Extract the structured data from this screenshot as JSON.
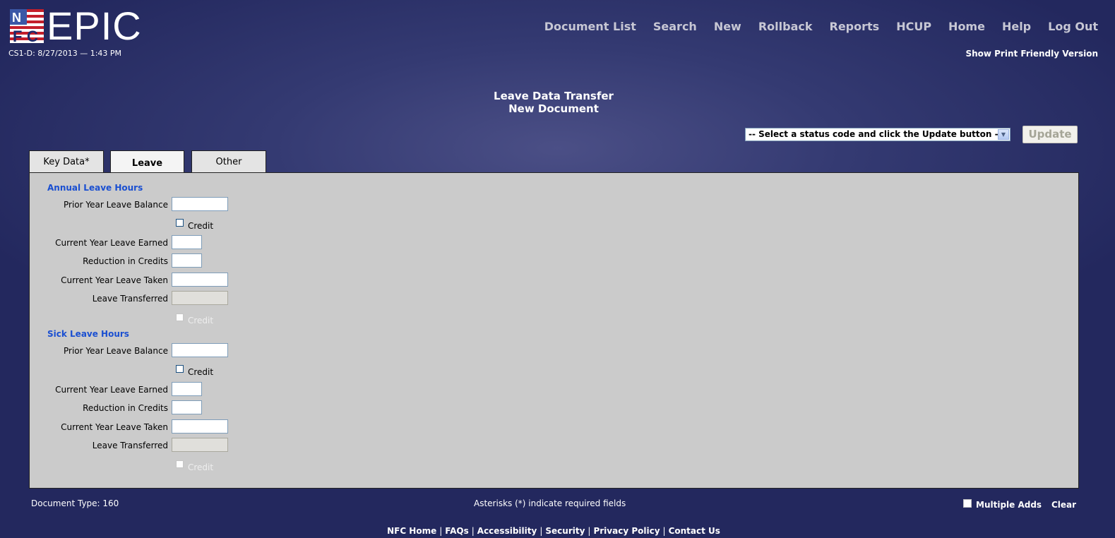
{
  "app": {
    "logo_text": "EPIC",
    "logo_letters": [
      "N",
      "F",
      "C"
    ],
    "timestamp": "CS1-D: 8/27/2013 — 1:43 PM"
  },
  "nav": [
    "Document List",
    "Search",
    "New",
    "Rollback",
    "Reports",
    "HCUP",
    "Home",
    "Help",
    "Log Out"
  ],
  "print_link": "Show Print Friendly Version",
  "page": {
    "title": "Leave Data Transfer",
    "subtitle": "New Document"
  },
  "status": {
    "selected": "-- Select a status code and click the Update button --",
    "update_label": "Update"
  },
  "tabs": [
    {
      "label": "Key Data*",
      "active": false
    },
    {
      "label": "Leave",
      "active": true
    },
    {
      "label": "Other",
      "active": false
    }
  ],
  "annual": {
    "heading": "Annual Leave Hours",
    "prior_balance": {
      "label": "Prior Year Leave Balance",
      "value": ""
    },
    "prior_credit": "Credit",
    "current_earned": {
      "label": "Current Year Leave Earned",
      "value": ""
    },
    "reduction": {
      "label": "Reduction in Credits",
      "value": ""
    },
    "current_taken": {
      "label": "Current Year Leave Taken",
      "value": ""
    },
    "transferred": {
      "label": "Leave Transferred",
      "value": ""
    },
    "transferred_credit": "Credit"
  },
  "sick": {
    "heading": "Sick Leave Hours",
    "prior_balance": {
      "label": "Prior Year Leave Balance",
      "value": ""
    },
    "prior_credit": "Credit",
    "current_earned": {
      "label": "Current Year Leave Earned",
      "value": ""
    },
    "reduction": {
      "label": "Reduction in Credits",
      "value": ""
    },
    "current_taken": {
      "label": "Current Year Leave Taken",
      "value": ""
    },
    "transferred": {
      "label": "Leave Transferred",
      "value": ""
    },
    "transferred_credit": "Credit"
  },
  "bottom": {
    "document_type": "Document Type: 160",
    "asterisk_note": "Asterisks (*) indicate required fields",
    "multiple_adds": "Multiple Adds",
    "clear": "Clear"
  },
  "footer": [
    "NFC Home",
    "FAQs",
    "Accessibility",
    "Security",
    "Privacy Policy",
    "Contact Us"
  ],
  "colors": {
    "background": "#2e336b",
    "nav_text": "#c7c7d4",
    "section_heading": "#1a4fd1",
    "panel": "#cbcbcb"
  }
}
